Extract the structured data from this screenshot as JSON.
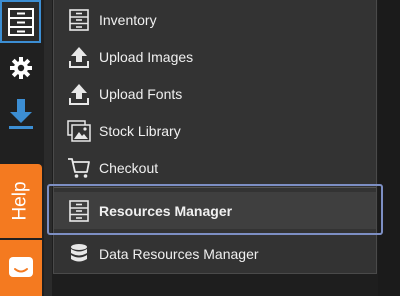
{
  "toolbar": {
    "buttons": [
      {
        "name": "inventory",
        "icon": "cabinet-icon"
      },
      {
        "name": "settings",
        "icon": "gear-icon"
      },
      {
        "name": "download",
        "icon": "download-arrow-icon"
      }
    ],
    "help_label": "Help",
    "chat_icon": "chat-bubble-icon",
    "accent": "#3c8ed3",
    "help_color": "#f47a20"
  },
  "menu": {
    "items": [
      {
        "label": "Inventory",
        "icon": "cabinet-icon"
      },
      {
        "label": "Upload Images",
        "icon": "upload-icon"
      },
      {
        "label": "Upload Fonts",
        "icon": "upload-icon"
      },
      {
        "label": "Stock Library",
        "icon": "image-stack-icon"
      },
      {
        "label": "Checkout",
        "icon": "cart-icon"
      },
      {
        "label": "Resources Manager",
        "icon": "cabinet-icon",
        "selected": true
      },
      {
        "label": "Data Resources Manager",
        "icon": "database-icon"
      }
    ],
    "selection_outline_color": "#7d8fc4"
  }
}
